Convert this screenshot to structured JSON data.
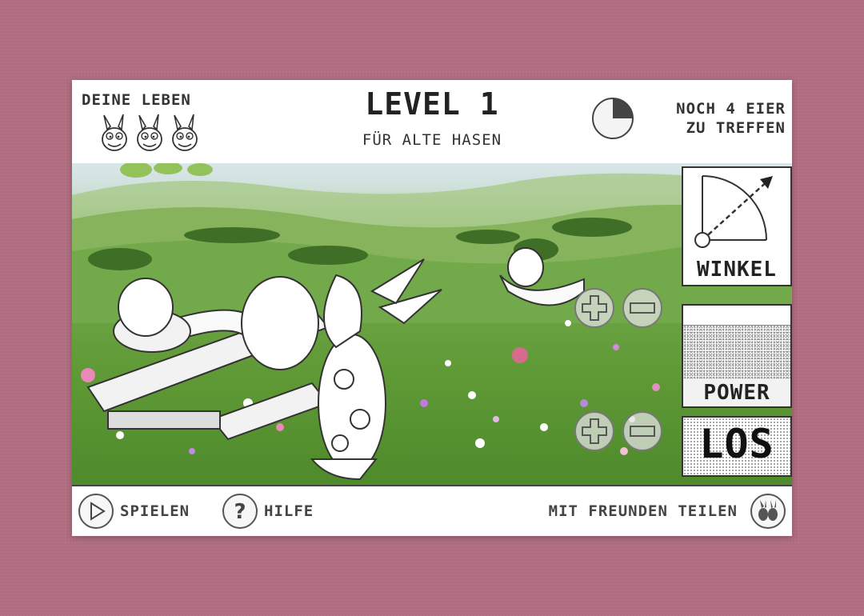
{
  "header": {
    "lives_label": "DEINE LEBEN",
    "lives": 3,
    "level_title": "LEVEL 1",
    "level_subtitle": "FÜR ALTE HASEN",
    "eggs_text": "NOCH 4 EIER\nZU TREFFEN"
  },
  "controls": {
    "winkel_label": "WINKEL",
    "power_label": "POWER",
    "los_label": "LOS"
  },
  "footer": {
    "play_label": "SPIELEN",
    "help_label": "HILFE",
    "share_label": "MIT FREUNDEN TEILEN"
  },
  "icons": {
    "play": "play-icon",
    "help": "question-icon",
    "share": "bunny-share-icon",
    "timer": "pie-timer-icon",
    "plus": "plus-icon",
    "minus": "minus-icon"
  },
  "colors": {
    "background": "#b06e80",
    "frame": "#ffffff",
    "ink": "#333333"
  }
}
